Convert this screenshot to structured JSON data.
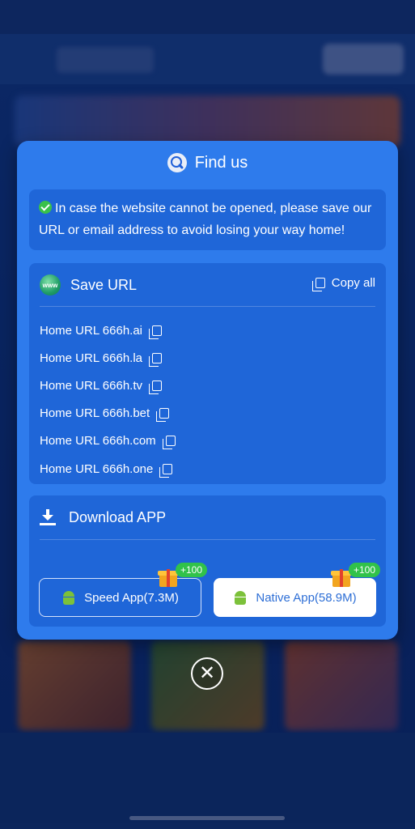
{
  "modal": {
    "title": "Find us",
    "notice": "In case the website cannot be opened, please save our URL or email address to avoid losing your way home!"
  },
  "save_url": {
    "icon_label": "www",
    "title": "Save URL",
    "copy_all": "Copy all",
    "urls": [
      "Home URL 666h.ai",
      "Home URL 666h.la",
      "Home URL 666h.tv",
      "Home URL 666h.bet",
      "Home URL 666h.com",
      "Home URL 666h.one"
    ]
  },
  "download": {
    "title": "Download APP",
    "speed_app": {
      "label": "Speed App(7.3M)",
      "bonus": "+100"
    },
    "native_app": {
      "label": "Native App(58.9M)",
      "bonus": "+100"
    }
  },
  "close": {
    "label": "✕"
  },
  "colors": {
    "modal_bg": "#2e7bec",
    "panel_bg": "#1f66d8",
    "bonus_badge": "#31c24a",
    "android": "#7cc13a"
  }
}
